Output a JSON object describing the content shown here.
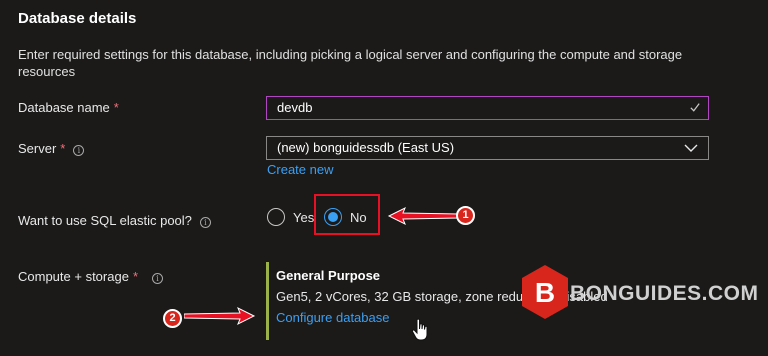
{
  "section": {
    "title": "Database details",
    "description": "Enter required settings for this database, including picking a logical server and configuring the compute and storage resources"
  },
  "database_name": {
    "label": "Database name",
    "required_mark": "*",
    "value": "devdb",
    "icon": "check-icon"
  },
  "server": {
    "label": "Server",
    "required_mark": "*",
    "info_glyph": "i",
    "value": "(new) bonguidessdb (East US)",
    "create_link": "Create new"
  },
  "elastic_pool": {
    "label": "Want to use SQL elastic pool?",
    "info_glyph": "i",
    "options": [
      "Yes",
      "No"
    ],
    "selected": "No"
  },
  "compute_storage": {
    "label": "Compute + storage",
    "required_mark": "*",
    "info_glyph": "i",
    "tier": "General Purpose",
    "detail": "Gen5, 2 vCores, 32 GB storage, zone redundant disabled",
    "configure_link": "Configure database"
  },
  "annotations": {
    "badge_1": "1",
    "badge_2": "2",
    "highlight_color": "#e81123",
    "arrow_color": "#e81123"
  },
  "watermark": {
    "logo_letter": "B",
    "text": "BONGUIDES.COM"
  },
  "colors": {
    "background": "#1b1a19",
    "accent_link": "#3aa0f3",
    "active_input_border": "#b146c2",
    "required": "#f1707b",
    "panel_bar": "#9bb14a"
  }
}
